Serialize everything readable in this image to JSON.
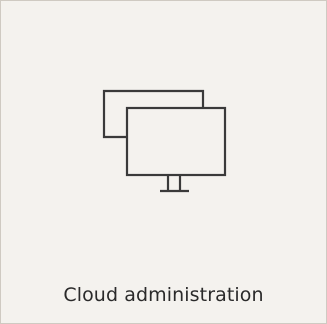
{
  "card": {
    "label": "Cloud administration",
    "icon": "dual-monitor-icon",
    "colors": {
      "background": "#f4f2ee",
      "border": "#cfcac2",
      "icon_stroke": "#3a3a3a",
      "text": "#2a2a2a"
    }
  }
}
